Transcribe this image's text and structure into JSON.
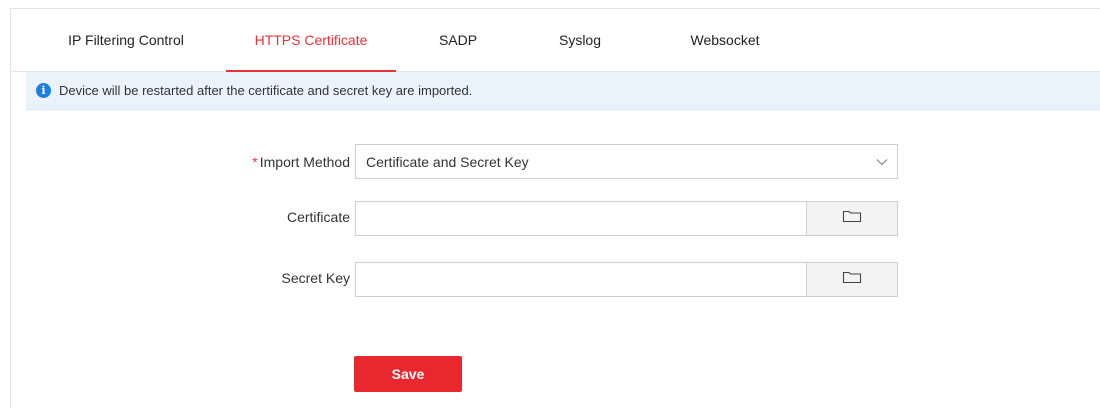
{
  "tabs": [
    {
      "label": "IP Filtering Control",
      "active": false
    },
    {
      "label": "HTTPS Certificate",
      "active": true
    },
    {
      "label": "SADP",
      "active": false
    },
    {
      "label": "Syslog",
      "active": false
    },
    {
      "label": "Websocket",
      "active": false
    }
  ],
  "notice": {
    "icon": "info-icon",
    "text": "Device will be restarted after the certificate and secret key are imported."
  },
  "form": {
    "import_method": {
      "required_mark": "*",
      "label": "Import Method",
      "selected": "Certificate and Secret Key"
    },
    "certificate": {
      "label": "Certificate",
      "value": ""
    },
    "secret_key": {
      "label": "Secret Key",
      "value": ""
    },
    "browse_icon": "folder-icon"
  },
  "actions": {
    "save_label": "Save"
  },
  "colors": {
    "accent": "#e8333a",
    "save_button": "#e8282e",
    "notice_bg": "#eaf3fc",
    "info_icon": "#1f7fe0"
  }
}
